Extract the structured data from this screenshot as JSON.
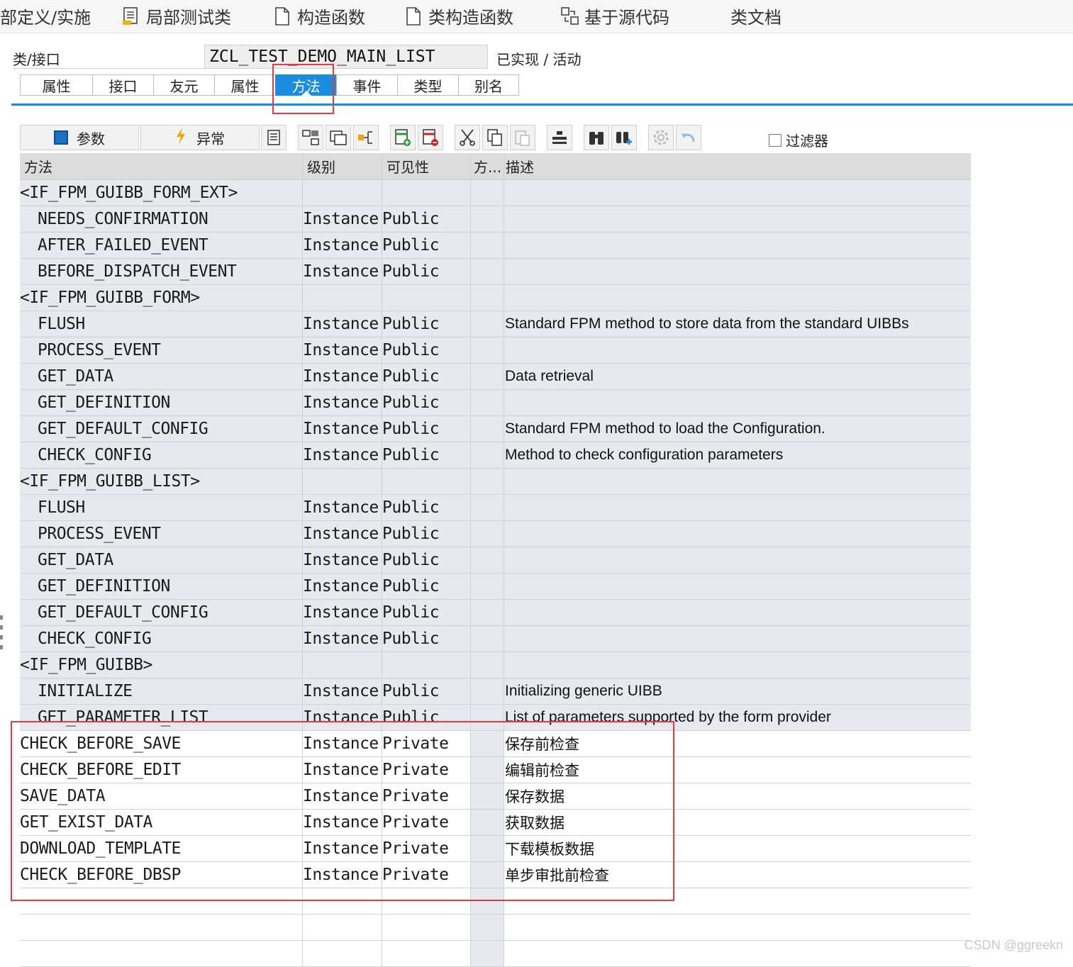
{
  "top_toolbar": {
    "items": [
      {
        "label": "部定义/实施",
        "icon": "none"
      },
      {
        "label": "局部测试类",
        "icon": "document-list-icon"
      },
      {
        "label": "构造函数",
        "icon": "document-icon"
      },
      {
        "label": "类构造函数",
        "icon": "document-icon"
      },
      {
        "label": "基于源代码",
        "icon": "source-code-icon"
      },
      {
        "label": "类文档",
        "icon": "none"
      }
    ]
  },
  "class_header": {
    "label": "类/接口",
    "name": "ZCL_TEST_DEMO_MAIN_LIST",
    "status": "已实现 / 活动"
  },
  "tabs": [
    {
      "label": "属性",
      "active": false
    },
    {
      "label": "接口",
      "active": false
    },
    {
      "label": "友元",
      "active": false
    },
    {
      "label": "属性",
      "active": false
    },
    {
      "label": "方法",
      "active": true
    },
    {
      "label": "事件",
      "active": false
    },
    {
      "label": "类型",
      "active": false
    },
    {
      "label": "别名",
      "active": false
    }
  ],
  "method_toolbar": {
    "parameters_label": "参数",
    "exceptions_label": "异常",
    "filter_label": "过滤器",
    "filter_checked": false
  },
  "table": {
    "columns": [
      "方法",
      "级别",
      "可见性",
      "方...",
      "描述"
    ],
    "rows": [
      {
        "method": "<IF_FPM_GUIBB_FORM_EXT>",
        "level": "",
        "visibility": "",
        "desc": "",
        "group": true
      },
      {
        "method": "NEEDS_CONFIRMATION",
        "level": "Instance",
        "visibility": "Public",
        "desc": ""
      },
      {
        "method": "AFTER_FAILED_EVENT",
        "level": "Instance",
        "visibility": "Public",
        "desc": ""
      },
      {
        "method": "BEFORE_DISPATCH_EVENT",
        "level": "Instance",
        "visibility": "Public",
        "desc": ""
      },
      {
        "method": "<IF_FPM_GUIBB_FORM>",
        "level": "",
        "visibility": "",
        "desc": "",
        "group": true
      },
      {
        "method": "FLUSH",
        "level": "Instance",
        "visibility": "Public",
        "desc": "Standard FPM method to store data from the standard UIBBs"
      },
      {
        "method": "PROCESS_EVENT",
        "level": "Instance",
        "visibility": "Public",
        "desc": ""
      },
      {
        "method": "GET_DATA",
        "level": "Instance",
        "visibility": "Public",
        "desc": "Data retrieval"
      },
      {
        "method": "GET_DEFINITION",
        "level": "Instance",
        "visibility": "Public",
        "desc": ""
      },
      {
        "method": "GET_DEFAULT_CONFIG",
        "level": "Instance",
        "visibility": "Public",
        "desc": "Standard FPM method to load the Configuration."
      },
      {
        "method": "CHECK_CONFIG",
        "level": "Instance",
        "visibility": "Public",
        "desc": "Method to check configuration parameters"
      },
      {
        "method": "<IF_FPM_GUIBB_LIST>",
        "level": "",
        "visibility": "",
        "desc": "",
        "group": true
      },
      {
        "method": "FLUSH",
        "level": "Instance",
        "visibility": "Public",
        "desc": ""
      },
      {
        "method": "PROCESS_EVENT",
        "level": "Instance",
        "visibility": "Public",
        "desc": ""
      },
      {
        "method": "GET_DATA",
        "level": "Instance",
        "visibility": "Public",
        "desc": ""
      },
      {
        "method": "GET_DEFINITION",
        "level": "Instance",
        "visibility": "Public",
        "desc": ""
      },
      {
        "method": "GET_DEFAULT_CONFIG",
        "level": "Instance",
        "visibility": "Public",
        "desc": ""
      },
      {
        "method": "CHECK_CONFIG",
        "level": "Instance",
        "visibility": "Public",
        "desc": ""
      },
      {
        "method": "<IF_FPM_GUIBB>",
        "level": "",
        "visibility": "",
        "desc": "",
        "group": true
      },
      {
        "method": "INITIALIZE",
        "level": "Instance",
        "visibility": "Public",
        "desc": "Initializing generic UIBB"
      },
      {
        "method": "GET_PARAMETER_LIST",
        "level": "Instance",
        "visibility": "Public",
        "desc": "List of parameters supported by the form provider"
      },
      {
        "method": "CHECK_BEFORE_SAVE",
        "level": "Instance",
        "visibility": "Private",
        "desc": "保存前检查",
        "own": true
      },
      {
        "method": "CHECK_BEFORE_EDIT",
        "level": "Instance",
        "visibility": "Private",
        "desc": "编辑前检查",
        "own": true
      },
      {
        "method": "SAVE_DATA",
        "level": "Instance",
        "visibility": "Private",
        "desc": "保存数据",
        "own": true
      },
      {
        "method": "GET_EXIST_DATA",
        "level": "Instance",
        "visibility": "Private",
        "desc": "获取数据",
        "own": true
      },
      {
        "method": "DOWNLOAD_TEMPLATE",
        "level": "Instance",
        "visibility": "Private",
        "desc": "下载模板数据",
        "own": true
      },
      {
        "method": "CHECK_BEFORE_DBSP",
        "level": "Instance",
        "visibility": "Private",
        "desc": "单步审批前检查",
        "own": true
      },
      {
        "method": "",
        "level": "",
        "visibility": "",
        "desc": "",
        "own": true
      },
      {
        "method": "",
        "level": "",
        "visibility": "",
        "desc": "",
        "own": true
      },
      {
        "method": "",
        "level": "",
        "visibility": "",
        "desc": "",
        "own": true
      }
    ]
  },
  "watermark": "CSDN @ggreekn",
  "colors": {
    "accent": "#1b8de0",
    "highlight_box": "#e23c3c",
    "row_alt": "#e6e9ed"
  }
}
